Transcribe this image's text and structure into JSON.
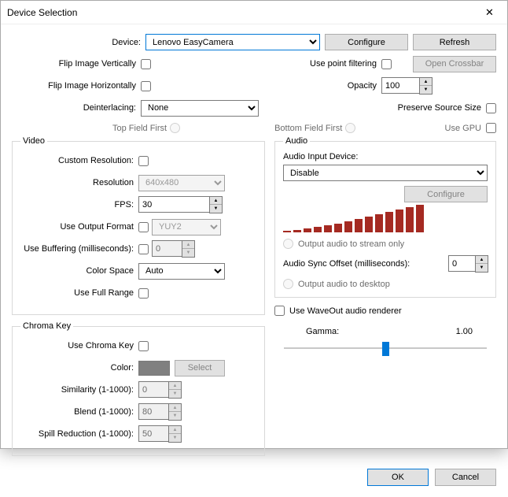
{
  "window": {
    "title": "Device Selection"
  },
  "header": {
    "device_label": "Device:",
    "device_value": "Lenovo EasyCamera",
    "configure_btn": "Configure",
    "refresh_btn": "Refresh",
    "flip_v": "Flip Image Vertically",
    "flip_h": "Flip Image Horizontally",
    "use_point": "Use point filtering",
    "open_crossbar": "Open Crossbar",
    "opacity_label": "Opacity",
    "opacity_value": "100",
    "deinterlacing_label": "Deinterlacing:",
    "deinterlacing_value": "None",
    "preserve_size": "Preserve Source Size",
    "top_field": "Top Field First",
    "bottom_field": "Bottom Field First",
    "use_gpu": "Use GPU"
  },
  "video": {
    "legend": "Video",
    "custom_res": "Custom Resolution:",
    "resolution_label": "Resolution",
    "resolution_value": "640x480",
    "fps_label": "FPS:",
    "fps_value": "30",
    "use_output_fmt": "Use Output Format",
    "output_fmt_value": "YUY2",
    "buffering_label": "Use Buffering (milliseconds):",
    "buffering_value": "0",
    "color_space_label": "Color Space",
    "color_space_value": "Auto",
    "full_range": "Use Full Range"
  },
  "chroma": {
    "legend": "Chroma Key",
    "use_key": "Use Chroma Key",
    "color_label": "Color:",
    "color_hex": "#808080",
    "select_btn": "Select",
    "similarity_label": "Similarity (1-1000):",
    "similarity_value": "0",
    "blend_label": "Blend (1-1000):",
    "blend_value": "80",
    "spill_label": "Spill Reduction (1-1000):",
    "spill_value": "50"
  },
  "audio": {
    "legend": "Audio",
    "input_label": "Audio Input Device:",
    "input_value": "Disable",
    "configure_btn": "Configure",
    "stream_only": "Output audio to stream only",
    "sync_label": "Audio Sync Offset (milliseconds):",
    "sync_value": "0",
    "desktop": "Output audio to desktop",
    "waveout": "Use WaveOut audio renderer",
    "gamma_label": "Gamma:",
    "gamma_value": "1.00"
  },
  "footer": {
    "ok": "OK",
    "cancel": "Cancel"
  },
  "chart_data": {
    "type": "bar",
    "categories": [
      "",
      "",
      "",
      "",
      "",
      "",
      "",
      "",
      "",
      "",
      "",
      "",
      "",
      ""
    ],
    "values": [
      2,
      3,
      5,
      7,
      9,
      11,
      14,
      17,
      20,
      23,
      26,
      29,
      32,
      35
    ],
    "title": "",
    "xlabel": "",
    "ylabel": "",
    "ylim": [
      0,
      35
    ]
  }
}
